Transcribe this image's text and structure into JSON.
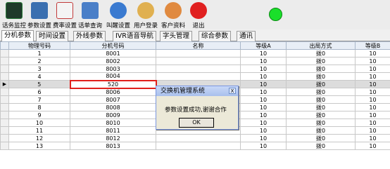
{
  "toolbar": {
    "buttons": [
      {
        "label": "话务监控",
        "icon": "monitor-icon",
        "color": "#2c7d3c"
      },
      {
        "label": "参数设置",
        "icon": "settings-icon",
        "color": "#3a6fb0"
      },
      {
        "label": "费率设置",
        "icon": "rate-icon",
        "color": "#c23a3a"
      },
      {
        "label": "话单查询",
        "icon": "query-icon",
        "color": "#4a7fc8"
      },
      {
        "label": "叫醒设置",
        "icon": "wakeup-icon",
        "color": "#3a7ad0"
      },
      {
        "label": "用户登录",
        "icon": "user-login-icon",
        "color": "#c48a20"
      },
      {
        "label": "客户资料",
        "icon": "customer-icon",
        "color": "#d06b20"
      },
      {
        "label": "退出",
        "icon": "exit-icon",
        "color": "#e02020"
      }
    ],
    "status_color": "#1adf2a"
  },
  "tabs": [
    "分机参数",
    "时间设置",
    "外线参数",
    "IVR语音导航",
    "字头管理",
    "综合参数",
    "通讯"
  ],
  "grid": {
    "columns": [
      "物理号码",
      "分机号码",
      "名称",
      "等级A",
      "出局方式",
      "等级B"
    ],
    "rows": [
      [
        "1",
        "8001",
        "",
        "10",
        "拨0",
        "10"
      ],
      [
        "2",
        "8002",
        "",
        "10",
        "拨0",
        "10"
      ],
      [
        "3",
        "8003",
        "",
        "10",
        "拨0",
        "10"
      ],
      [
        "4",
        "8004",
        "",
        "10",
        "拨0",
        "10"
      ],
      [
        "5",
        "520",
        "",
        "10",
        "拨0",
        "10"
      ],
      [
        "6",
        "8006",
        "",
        "10",
        "拨0",
        "10"
      ],
      [
        "7",
        "8007",
        "",
        "10",
        "拨0",
        "10"
      ],
      [
        "8",
        "8008",
        "",
        "10",
        "拨0",
        "10"
      ],
      [
        "9",
        "8009",
        "",
        "10",
        "拨0",
        "10"
      ],
      [
        "10",
        "8010",
        "",
        "10",
        "拨0",
        "10"
      ],
      [
        "11",
        "8011",
        "",
        "10",
        "拨0",
        "10"
      ],
      [
        "12",
        "8012",
        "",
        "10",
        "拨0",
        "10"
      ],
      [
        "13",
        "8013",
        "",
        "10",
        "拨0",
        "10"
      ]
    ],
    "current_row_marker": "▶"
  },
  "dialog": {
    "title": "交换机管理系统",
    "message": "参数设置成功,谢谢合作",
    "ok_label": "OK",
    "close_label": "X"
  }
}
